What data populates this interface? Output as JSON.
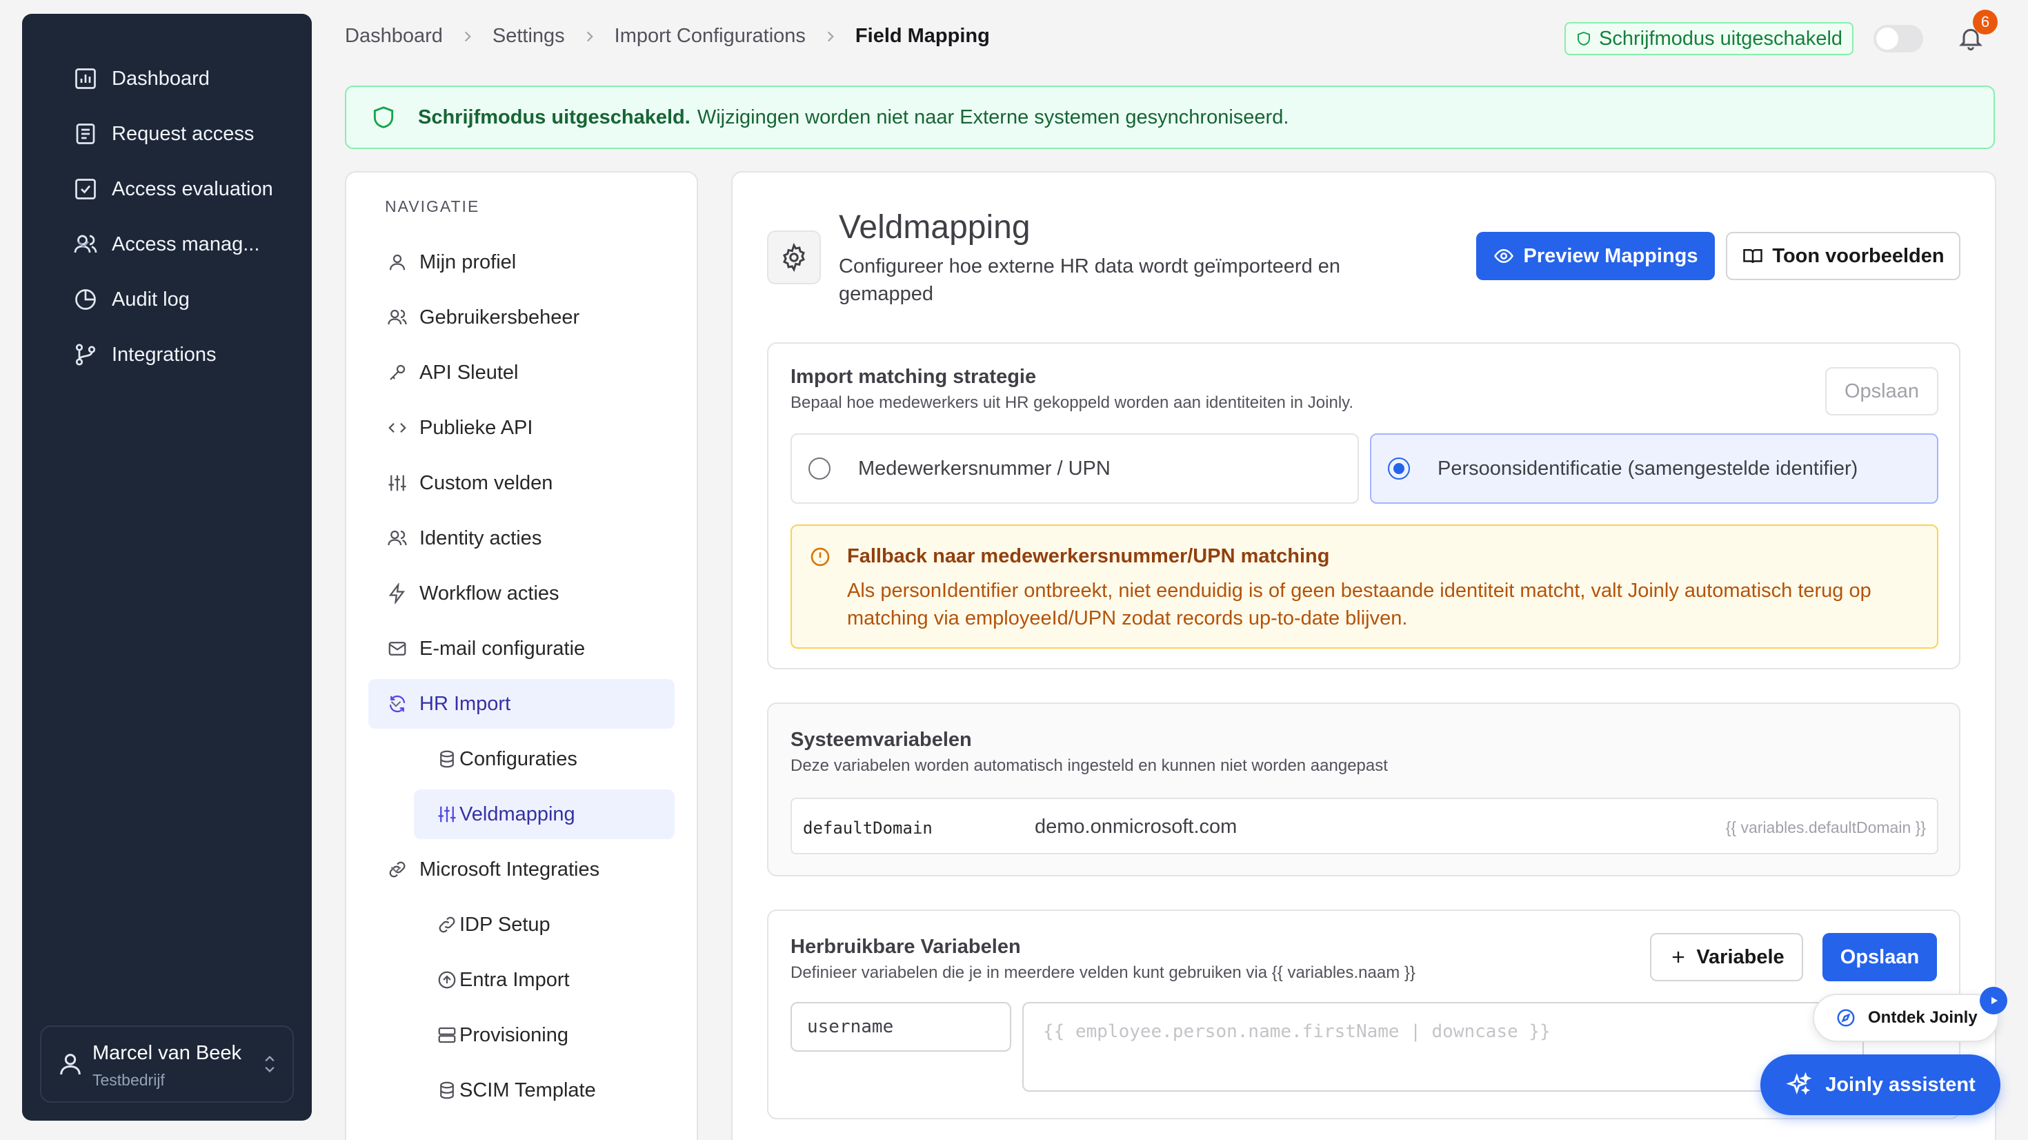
{
  "app_nav": {
    "items": [
      {
        "label": "Dashboard",
        "icon": "chart-icon"
      },
      {
        "label": "Request access",
        "icon": "clipboard-icon"
      },
      {
        "label": "Access evaluation",
        "icon": "check-square-icon"
      },
      {
        "label": "Access manag...",
        "icon": "users-icon"
      },
      {
        "label": "Audit log",
        "icon": "pie-icon"
      },
      {
        "label": "Integrations",
        "icon": "branch-icon"
      }
    ]
  },
  "user": {
    "name": "Marcel van Beek",
    "company": "Testbedrijf"
  },
  "breadcrumb": [
    "Dashboard",
    "Settings",
    "Import Configurations",
    "Field Mapping"
  ],
  "header": {
    "readonly_badge": "Schrijfmodus uitgeschakeld",
    "notification_count": "6"
  },
  "alert": {
    "title": "Schrijfmodus uitgeschakeld.",
    "message": "Wijzigingen worden niet naar Externe systemen gesynchroniseerd."
  },
  "settings_nav": {
    "heading": "NAVIGATIE",
    "items": [
      "Mijn profiel",
      "Gebruikersbeheer",
      "API Sleutel",
      "Publieke API",
      "Custom velden",
      "Identity acties",
      "Workflow acties",
      "E-mail configuratie",
      "HR Import",
      "Configuraties",
      "Veldmapping",
      "Microsoft Integraties",
      "IDP Setup",
      "Entra Import",
      "Provisioning",
      "SCIM Template"
    ]
  },
  "page": {
    "title": "Veldmapping",
    "subtitle": "Configureer hoe externe HR data wordt geïmporteerd en gemapped",
    "preview_button": "Preview Mappings",
    "examples_button": "Toon voorbeelden"
  },
  "strategy": {
    "title": "Import matching strategie",
    "description": "Bepaal hoe medewerkers uit HR gekoppeld worden aan identiteiten in Joinly.",
    "save_label": "Opslaan",
    "options": [
      "Medewerkersnummer / UPN",
      "Persoonsidentificatie (samengestelde identifier)"
    ],
    "selected": "Persoonsidentificatie (samengestelde identifier)",
    "fallback_title": "Fallback naar medewerkersnummer/UPN matching",
    "fallback_body": "Als personIdentifier ontbreekt, niet eenduidig is of geen bestaande identiteit matcht, valt Joinly automatisch terug op matching via employeeId/UPN zodat records up-to-date blijven."
  },
  "system_vars": {
    "title": "Systeemvariabelen",
    "description": "Deze variabelen worden automatisch ingesteld en kunnen niet worden aangepast",
    "rows": [
      {
        "key": "defaultDomain",
        "value": "demo.onmicrosoft.com",
        "template": "{{ variables.defaultDomain }}"
      }
    ]
  },
  "reusable_vars": {
    "title": "Herbruikbare Variabelen",
    "description": "Definieer variabelen die je in meerdere velden kunt gebruiken via {{ variables.naam }}",
    "add_label": "Variabele",
    "save_label": "Opslaan",
    "name_value": "username",
    "expression_placeholder": "{{ employee.person.name.firstName | downcase }}"
  },
  "assistant": {
    "discover_label": "Ontdek Joinly",
    "assistant_label": "Joinly assistent"
  },
  "colors": {
    "sidebar_bg": "#1e2738",
    "primary": "#2563eb",
    "success": "#15803d",
    "warning": "#b45309",
    "badge": "#ea580c"
  }
}
